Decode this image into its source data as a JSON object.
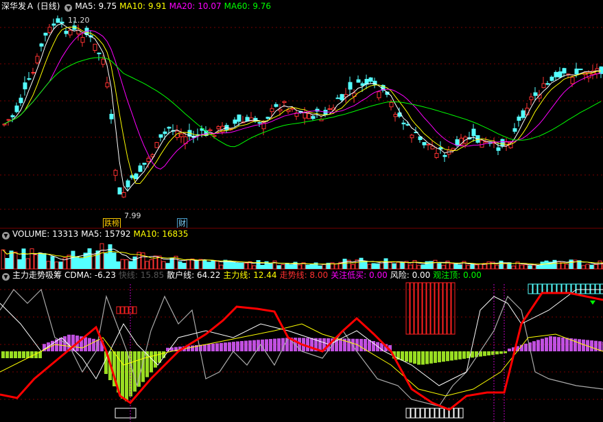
{
  "price_header": {
    "stock_name": "深华发Ａ",
    "period": "(日线)",
    "ma5": "MA5: 9.75",
    "ma10": "MA10: 9.91",
    "ma20": "MA20: 10.07",
    "ma60": "MA60: 9.76"
  },
  "price_labels": {
    "high": "11.20",
    "low": "7.99",
    "tag_rebate": "跌榜",
    "tag_finance": "财"
  },
  "volume_header": {
    "volume": "VOLUME: 13313",
    "ma5": "MA5: 15792",
    "ma10": "MA10: 16835"
  },
  "indicator_header": {
    "name": "主力走势吸筹",
    "cdma": "CDMA: -6.23",
    "fast": "快线: 15.85",
    "retail": "散户线: 64.22",
    "main": "主力线: 12.44",
    "trend": "走势线: 8.00",
    "watch_buy": "关注低买: 0.00",
    "risk": "风险: 0.00",
    "watch_top": "观注顶: 0.00"
  },
  "colors": {
    "background": "#000000",
    "up": "#ff3232",
    "down": "#54ffff",
    "ma5": "#ffffff",
    "ma10": "#ffff00",
    "ma20": "#ff00ff",
    "ma60": "#00ff00",
    "separator": "#6e0000",
    "purple_bar": "#c050e0",
    "green_bar": "#99dd22",
    "main_line": "#ff0000",
    "retail_line": "#aaaaaa"
  },
  "icons": {
    "panel_toggle": "chevron-down-icon"
  }
}
